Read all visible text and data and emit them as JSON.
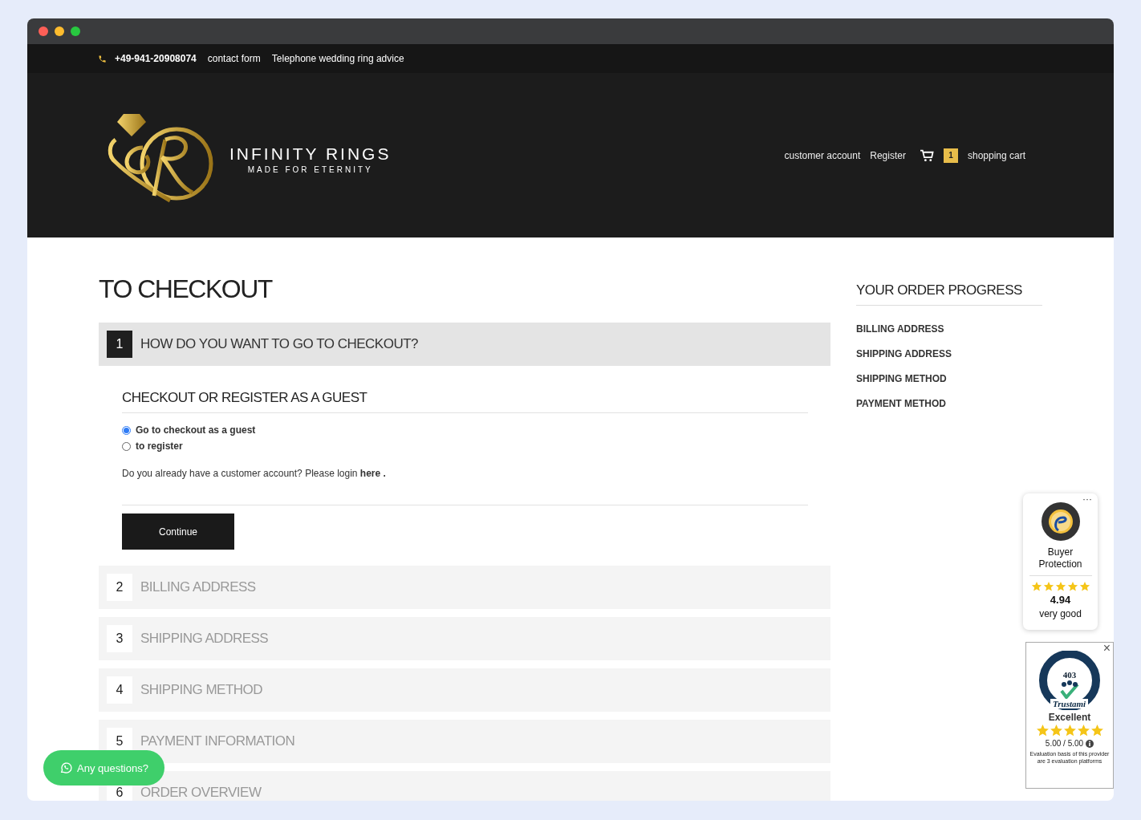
{
  "topbar": {
    "phone": "+49-941-20908074",
    "links": [
      "contact form",
      "Telephone wedding ring advice"
    ]
  },
  "header": {
    "brand": "INFINITY RINGS",
    "tagline": "MADE FOR ETERNITY",
    "nav": [
      "customer account",
      "Register"
    ],
    "cart_count": "1",
    "cart_label": "shopping cart"
  },
  "checkout": {
    "title": "TO CHECKOUT",
    "steps": [
      {
        "number": "1",
        "title": "HOW DO YOU WANT TO GO TO CHECKOUT?",
        "expanded": true
      },
      {
        "number": "2",
        "title": "BILLING ADDRESS",
        "expanded": false
      },
      {
        "number": "3",
        "title": "SHIPPING ADDRESS",
        "expanded": false
      },
      {
        "number": "4",
        "title": "SHIPPING METHOD",
        "expanded": false
      },
      {
        "number": "5",
        "title": "PAYMENT INFORMATION",
        "expanded": false
      },
      {
        "number": "6",
        "title": "ORDER OVERVIEW",
        "expanded": false
      }
    ],
    "section_title": "CHECKOUT OR REGISTER AS A GUEST",
    "options": [
      {
        "label": "Go to checkout as a guest",
        "selected": true
      },
      {
        "label": "to register",
        "selected": false
      }
    ],
    "login_prompt": "Do you already have a customer account? Please login **here .**",
    "continue_button": "Continue"
  },
  "progress": {
    "title": "YOUR ORDER PROGRESS",
    "items": [
      "BILLING ADDRESS",
      "SHIPPING ADDRESS",
      "SHIPPING METHOD",
      "PAYMENT METHOD"
    ]
  },
  "trusted_shops": {
    "menu": "···",
    "label": "Buyer Protection",
    "stars": 5,
    "score": "4.94",
    "rating": "very good"
  },
  "trustami": {
    "close": "×",
    "count": "403",
    "brand": "Trustami",
    "rating": "Excellent",
    "stars": 5,
    "score": "5.00 / 5.00",
    "note": "Evaluation basis of this provider are 3 evaluation platforms"
  },
  "chat_button": "Any questions?"
}
